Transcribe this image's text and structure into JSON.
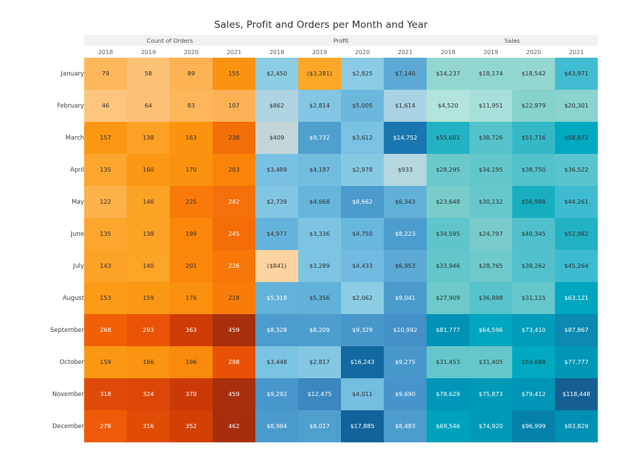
{
  "title": "Sales, Profit and Orders per Month and Year",
  "row_header_label": "",
  "groups": [
    {
      "label": "Count of Orders",
      "years": [
        "2018",
        "2019",
        "2020",
        "2021"
      ]
    },
    {
      "label": "Profit",
      "years": [
        "2018",
        "2019",
        "2020",
        "2021"
      ]
    },
    {
      "label": "Sales",
      "years": [
        "2018",
        "2019",
        "2020",
        "2021"
      ]
    }
  ],
  "months": [
    "January",
    "February",
    "March",
    "April",
    "May",
    "June",
    "July",
    "August",
    "September",
    "October",
    "November",
    "December"
  ],
  "chart_data": {
    "type": "heatmap",
    "title": "Sales, Profit and Orders per Month and Year",
    "xlabel": "",
    "ylabel": "",
    "legend": "none",
    "grid": false,
    "row_categories": [
      "January",
      "February",
      "March",
      "April",
      "May",
      "June",
      "July",
      "August",
      "September",
      "October",
      "November",
      "December"
    ],
    "column_groups": [
      "Count of Orders",
      "Profit",
      "Sales"
    ],
    "column_years": [
      "2018",
      "2019",
      "2020",
      "2021"
    ],
    "measures": [
      {
        "name": "Count of Orders",
        "format": "integer",
        "color_scale": "orange",
        "series": [
          {
            "name": "2018",
            "values": [
              79,
              46,
              157,
              135,
              122,
              135,
              143,
              153,
              268,
              159,
              318,
              278
            ]
          },
          {
            "name": "2019",
            "values": [
              58,
              64,
              138,
              160,
              146,
              138,
              140,
              159,
              293,
              166,
              324,
              316
            ]
          },
          {
            "name": "2020",
            "values": [
              89,
              83,
              163,
              170,
              225,
              199,
              201,
              176,
              363,
              196,
              370,
              352
            ]
          },
          {
            "name": "2021",
            "values": [
              155,
              107,
              238,
              203,
              242,
              245,
              226,
              218,
              459,
              298,
              459,
              462
            ]
          }
        ]
      },
      {
        "name": "Profit",
        "format": "currency",
        "color_scale": "blue-orange-diverging",
        "series": [
          {
            "name": "2018",
            "values": [
              2450,
              862,
              409,
              3489,
              2739,
              4977,
              -841,
              5318,
              8328,
              3448,
              9292,
              8984
            ]
          },
          {
            "name": "2019",
            "values": [
              -3281,
              2814,
              9732,
              4187,
              4668,
              3336,
              3289,
              5356,
              8209,
              2817,
              12475,
              8017
            ]
          },
          {
            "name": "2020",
            "values": [
              2825,
              5005,
              3612,
              2978,
              8662,
              4750,
              4433,
              2062,
              9329,
              16243,
              4011,
              17885
            ]
          },
          {
            "name": "2021",
            "values": [
              7140,
              1614,
              14752,
              933,
              6343,
              8223,
              6953,
              9041,
              10992,
              9275,
              9690,
              8483
            ]
          }
        ]
      },
      {
        "name": "Sales",
        "format": "currency",
        "color_scale": "teal",
        "series": [
          {
            "name": "2018",
            "values": [
              14237,
              4520,
              55601,
              28295,
              23648,
              34595,
              33946,
              27909,
              81777,
              31453,
              78629,
              69546
            ]
          },
          {
            "name": "2019",
            "values": [
              18174,
              11951,
              38726,
              34195,
              30132,
              24797,
              28765,
              36898,
              64596,
              31405,
              75873,
              74920
            ]
          },
          {
            "name": "2020",
            "values": [
              18542,
              22979,
              51716,
              38750,
              56988,
              40345,
              39262,
              31115,
              73410,
              59688,
              79412,
              96999
            ]
          },
          {
            "name": "2021",
            "values": [
              43971,
              20301,
              58872,
              36522,
              44261,
              52982,
              45264,
              63121,
              87867,
              77777,
              118448,
              83829
            ]
          }
        ]
      }
    ]
  },
  "cells": {
    "January": [
      {
        "text": "79",
        "bg": "#fcb75a",
        "light": false
      },
      {
        "text": "58",
        "bg": "#fcc275",
        "light": false
      },
      {
        "text": "89",
        "bg": "#fdb253",
        "light": false
      },
      {
        "text": "155",
        "bg": "#fb9212",
        "light": false
      },
      {
        "text": "$2,450",
        "bg": "#8ccde4",
        "light": false
      },
      {
        "text": "($3,281)",
        "bg": "#fba728",
        "light": false
      },
      {
        "text": "$2,825",
        "bg": "#8bcce4",
        "light": false
      },
      {
        "text": "$7,140",
        "bg": "#5ba9d4",
        "light": false
      },
      {
        "text": "$14,237",
        "bg": "#93d6cf",
        "light": false
      },
      {
        "text": "$18,174",
        "bg": "#92d6d0",
        "light": false
      },
      {
        "text": "$18,542",
        "bg": "#94d7d0",
        "light": false
      },
      {
        "text": "$43,971",
        "bg": "#41bcd0",
        "light": false
      }
    ],
    "February": [
      {
        "text": "46",
        "bg": "#fdc67e",
        "light": false
      },
      {
        "text": "64",
        "bg": "#fdc077",
        "light": false
      },
      {
        "text": "83",
        "bg": "#fdb659",
        "light": false
      },
      {
        "text": "107",
        "bg": "#fdb155",
        "light": false
      },
      {
        "text": "$862",
        "bg": "#aed3e1",
        "light": false
      },
      {
        "text": "$2,814",
        "bg": "#82c6e3",
        "light": false
      },
      {
        "text": "$5,005",
        "bg": "#6cb7dc",
        "light": false
      },
      {
        "text": "$1,614",
        "bg": "#a9d2e2",
        "light": false
      },
      {
        "text": "$4,520",
        "bg": "#b3e4db",
        "light": false
      },
      {
        "text": "$11,951",
        "bg": "#a8e0d9",
        "light": false
      },
      {
        "text": "$22,979",
        "bg": "#86d2cd",
        "light": false
      },
      {
        "text": "$20,301",
        "bg": "#8ad3ce",
        "light": false
      }
    ],
    "March": [
      {
        "text": "157",
        "bg": "#fb9813",
        "light": false
      },
      {
        "text": "138",
        "bg": "#fca125",
        "light": false
      },
      {
        "text": "163",
        "bg": "#fb930f",
        "light": false
      },
      {
        "text": "238",
        "bg": "#f36f08",
        "light": false
      },
      {
        "text": "$409",
        "bg": "#c3d5d9",
        "light": false
      },
      {
        "text": "$9,732",
        "bg": "#4f9fcf",
        "light": true
      },
      {
        "text": "$3,612",
        "bg": "#79c2e2",
        "light": false
      },
      {
        "text": "$14,752",
        "bg": "#1a76ae",
        "light": true
      },
      {
        "text": "$55,601",
        "bg": "#22b2c2",
        "light": false
      },
      {
        "text": "$38,726",
        "bg": "#56c3cb",
        "light": false
      },
      {
        "text": "$51,716",
        "bg": "#35b8c6",
        "light": false
      },
      {
        "text": "$58,872",
        "bg": "#00a8c0",
        "light": false
      }
    ],
    "April": [
      {
        "text": "135",
        "bg": "#fca62e",
        "light": false
      },
      {
        "text": "160",
        "bg": "#fb9712",
        "light": false
      },
      {
        "text": "170",
        "bg": "#fb920e",
        "light": false
      },
      {
        "text": "203",
        "bg": "#fa8409",
        "light": false
      },
      {
        "text": "$3,489",
        "bg": "#78c1e2",
        "light": false
      },
      {
        "text": "$4,187",
        "bg": "#72bce0",
        "light": false
      },
      {
        "text": "$2,978",
        "bg": "#86c9e3",
        "light": false
      },
      {
        "text": "$933",
        "bg": "#b6d6e0",
        "light": false
      },
      {
        "text": "$28,295",
        "bg": "#6cc9cb",
        "light": false
      },
      {
        "text": "$34,195",
        "bg": "#62c6cb",
        "light": false
      },
      {
        "text": "$38,750",
        "bg": "#53c2cb",
        "light": false
      },
      {
        "text": "$36,522",
        "bg": "#59c4cb",
        "light": false
      }
    ],
    "May": [
      {
        "text": "122",
        "bg": "#fdb14b",
        "light": false
      },
      {
        "text": "146",
        "bg": "#fca326",
        "light": false
      },
      {
        "text": "225",
        "bg": "#f87b09",
        "light": false
      },
      {
        "text": "242",
        "bg": "#f4700a",
        "light": true
      },
      {
        "text": "$2,739",
        "bg": "#82c6e3",
        "light": false
      },
      {
        "text": "$4,668",
        "bg": "#66b5db",
        "light": false
      },
      {
        "text": "$8,662",
        "bg": "#4b9bcd",
        "light": true
      },
      {
        "text": "$6,343",
        "bg": "#60b0d8",
        "light": false
      },
      {
        "text": "$23,648",
        "bg": "#79ccca",
        "light": false
      },
      {
        "text": "$30,132",
        "bg": "#67c8cb",
        "light": false
      },
      {
        "text": "$56,988",
        "bg": "#18aec0",
        "light": false
      },
      {
        "text": "$44,261",
        "bg": "#3fbbd0",
        "light": false
      }
    ],
    "June": [
      {
        "text": "135",
        "bg": "#fca62e",
        "light": false
      },
      {
        "text": "138",
        "bg": "#fca325",
        "light": false
      },
      {
        "text": "199",
        "bg": "#fa870a",
        "light": false
      },
      {
        "text": "245",
        "bg": "#f36d08",
        "light": true
      },
      {
        "text": "$4,977",
        "bg": "#64b3da",
        "light": false
      },
      {
        "text": "$3,336",
        "bg": "#7dc4e2",
        "light": false
      },
      {
        "text": "$4,750",
        "bg": "#68b7dc",
        "light": false
      },
      {
        "text": "$8,223",
        "bg": "#4c9dce",
        "light": true
      },
      {
        "text": "$34,595",
        "bg": "#5fc5cb",
        "light": false
      },
      {
        "text": "$24,797",
        "bg": "#78cbca",
        "light": false
      },
      {
        "text": "$40,345",
        "bg": "#4fc0cc",
        "light": false
      },
      {
        "text": "$52,982",
        "bg": "#23b2c3",
        "light": false
      }
    ],
    "July": [
      {
        "text": "143",
        "bg": "#fca227",
        "light": false
      },
      {
        "text": "140",
        "bg": "#fca425",
        "light": false
      },
      {
        "text": "201",
        "bg": "#fa860a",
        "light": false
      },
      {
        "text": "226",
        "bg": "#f67809",
        "light": true
      },
      {
        "text": "($841)",
        "bg": "#fcd3a1",
        "light": false
      },
      {
        "text": "$3,289",
        "bg": "#7dc4e2",
        "light": false
      },
      {
        "text": "$4,433",
        "bg": "#70bbdf",
        "light": false
      },
      {
        "text": "$6,953",
        "bg": "#5ca9d5",
        "light": false
      },
      {
        "text": "$33,946",
        "bg": "#62c6cb",
        "light": false
      },
      {
        "text": "$28,765",
        "bg": "#6ec9ca",
        "light": false
      },
      {
        "text": "$39,262",
        "bg": "#52c1cc",
        "light": false
      },
      {
        "text": "$45,264",
        "bg": "#3dbbd0",
        "light": false
      }
    ],
    "August": [
      {
        "text": "153",
        "bg": "#fc9b17",
        "light": false
      },
      {
        "text": "159",
        "bg": "#fb9813",
        "light": false
      },
      {
        "text": "176",
        "bg": "#fb900d",
        "light": false
      },
      {
        "text": "218",
        "bg": "#f77c09",
        "light": false
      },
      {
        "text": "$5,318",
        "bg": "#62b2d9",
        "light": true
      },
      {
        "text": "$5,356",
        "bg": "#61b1d8",
        "light": false
      },
      {
        "text": "$2,062",
        "bg": "#8ccde4",
        "light": false
      },
      {
        "text": "$9,041",
        "bg": "#4a9acc",
        "light": true
      },
      {
        "text": "$27,909",
        "bg": "#6dc9ca",
        "light": false
      },
      {
        "text": "$36,898",
        "bg": "#57c3cb",
        "light": false
      },
      {
        "text": "$31,115",
        "bg": "#65c7cb",
        "light": false
      },
      {
        "text": "$63,121",
        "bg": "#00a6bf",
        "light": true
      }
    ],
    "September": [
      {
        "text": "268",
        "bg": "#f15f07",
        "light": true
      },
      {
        "text": "293",
        "bg": "#ea5306",
        "light": true
      },
      {
        "text": "363",
        "bg": "#ce3c06",
        "light": true
      },
      {
        "text": "459",
        "bg": "#a82f0c",
        "light": true
      },
      {
        "text": "$8,328",
        "bg": "#4c9dce",
        "light": true
      },
      {
        "text": "$8,209",
        "bg": "#4d9ece",
        "light": true
      },
      {
        "text": "$9,329",
        "bg": "#4897cb",
        "light": true
      },
      {
        "text": "$10,992",
        "bg": "#4390c6",
        "light": true
      },
      {
        "text": "$81,777",
        "bg": "#0092b4",
        "light": true
      },
      {
        "text": "$64,596",
        "bg": "#00a6be",
        "light": true
      },
      {
        "text": "$73,410",
        "bg": "#009cb9",
        "light": true
      },
      {
        "text": "$87,867",
        "bg": "#0b89ae",
        "light": true
      }
    ],
    "October": [
      {
        "text": "159",
        "bg": "#fb9813",
        "light": false
      },
      {
        "text": "166",
        "bg": "#fb940f",
        "light": false
      },
      {
        "text": "196",
        "bg": "#fa8a0b",
        "light": false
      },
      {
        "text": "298",
        "bg": "#e95206",
        "light": true
      },
      {
        "text": "$3,448",
        "bg": "#7bc3e2",
        "light": false
      },
      {
        "text": "$2,817",
        "bg": "#83c7e3",
        "light": false
      },
      {
        "text": "$16,243",
        "bg": "#12699f",
        "light": true
      },
      {
        "text": "$9,275",
        "bg": "#4897cb",
        "light": true
      },
      {
        "text": "$31,453",
        "bg": "#65c7cb",
        "light": false
      },
      {
        "text": "$31,405",
        "bg": "#66c7cb",
        "light": false
      },
      {
        "text": "$59,688",
        "bg": "#00a9c0",
        "light": false
      },
      {
        "text": "$77,777",
        "bg": "#0097b7",
        "light": true
      }
    ],
    "November": [
      {
        "text": "318",
        "bg": "#df4a06",
        "light": true
      },
      {
        "text": "324",
        "bg": "#dc4706",
        "light": true
      },
      {
        "text": "370",
        "bg": "#ca3a06",
        "light": true
      },
      {
        "text": "459",
        "bg": "#a82f0c",
        "light": true
      },
      {
        "text": "$9,292",
        "bg": "#4897cb",
        "light": true
      },
      {
        "text": "$12,475",
        "bg": "#3c87bf",
        "light": true
      },
      {
        "text": "$4,011",
        "bg": "#74bee0",
        "light": false
      },
      {
        "text": "$9,690",
        "bg": "#4694c9",
        "light": true
      },
      {
        "text": "$78,629",
        "bg": "#0096b7",
        "light": true
      },
      {
        "text": "$75,873",
        "bg": "#0099b8",
        "light": true
      },
      {
        "text": "$79,412",
        "bg": "#0095b6",
        "light": true
      },
      {
        "text": "$118,448",
        "bg": "#175f93",
        "light": true
      }
    ],
    "December": [
      {
        "text": "278",
        "bg": "#ee5a07",
        "light": true
      },
      {
        "text": "316",
        "bg": "#e04b06",
        "light": true
      },
      {
        "text": "352",
        "bg": "#d24006",
        "light": true
      },
      {
        "text": "462",
        "bg": "#a72e0c",
        "light": true
      },
      {
        "text": "$8,984",
        "bg": "#4a9acc",
        "light": true
      },
      {
        "text": "$8,017",
        "bg": "#4f9fcf",
        "light": true
      },
      {
        "text": "$17,885",
        "bg": "#11639a",
        "light": true
      },
      {
        "text": "$8,483",
        "bg": "#4c9cce",
        "light": true
      },
      {
        "text": "$69,546",
        "bg": "#00a1bb",
        "light": true
      },
      {
        "text": "$74,920",
        "bg": "#009ab8",
        "light": true
      },
      {
        "text": "$96,999",
        "bg": "#0580a9",
        "light": true
      },
      {
        "text": "$83,829",
        "bg": "#0090b3",
        "light": true
      }
    ]
  }
}
